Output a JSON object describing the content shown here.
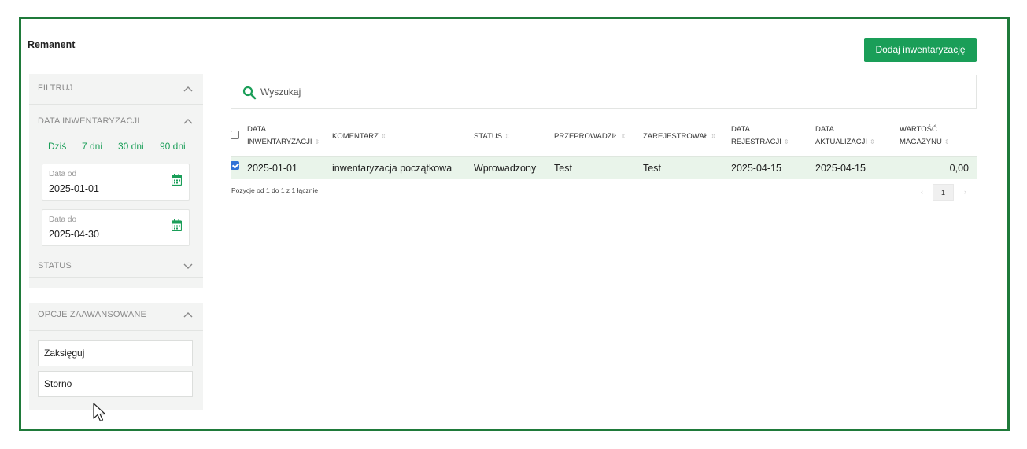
{
  "page": {
    "title": "Remanent",
    "add_button": "Dodaj inwentaryzację"
  },
  "filters": {
    "header": "FILTRUJ",
    "date_section": "DATA INWENTARYZACJI",
    "quick_ranges": [
      "Dziś",
      "7 dni",
      "30 dni",
      "90 dni"
    ],
    "date_from": {
      "label": "Data od",
      "value": "2025-01-01"
    },
    "date_to": {
      "label": "Data do",
      "value": "2025-04-30"
    },
    "status_section": "STATUS"
  },
  "advanced": {
    "header": "OPCJE ZAAWANSOWANE",
    "actions": [
      "Zaksięguj",
      "Storno"
    ]
  },
  "search": {
    "placeholder": "Wyszukaj"
  },
  "table": {
    "columns": [
      [
        "DATA",
        "INWENTARYZACJI"
      ],
      [
        "KOMENTARZ"
      ],
      [
        "STATUS"
      ],
      [
        "PRZEPROWADZIŁ"
      ],
      [
        "ZAREJESTROWAŁ"
      ],
      [
        "DATA",
        "REJESTRACJI"
      ],
      [
        "DATA",
        "AKTUALIZACJI"
      ],
      [
        "WARTOŚĆ",
        "MAGAZYNU"
      ]
    ],
    "rows": [
      {
        "selected": true,
        "cells": [
          "2025-01-01",
          "inwentaryzacja początkowa",
          "Wprowadzony",
          "Test",
          "Test",
          "2025-04-15",
          "2025-04-15",
          "0,00"
        ]
      }
    ],
    "info": "Pozycje od 1 do 1 z 1 łącznie",
    "pagination": {
      "prev": "‹",
      "current": "1",
      "next": "›"
    }
  },
  "colors": {
    "accent": "#1a9e58",
    "frame": "#1f7a3a",
    "selected_row": "#e9f4ea"
  }
}
